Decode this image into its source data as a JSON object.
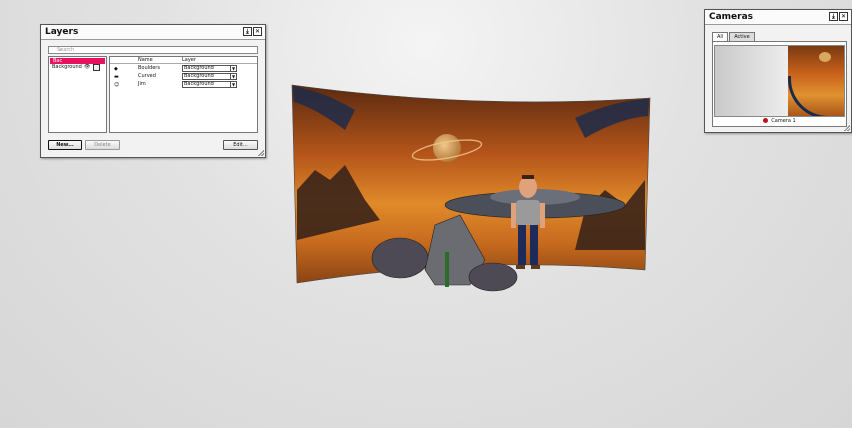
{
  "layers_panel": {
    "title": "Layers",
    "search_placeholder": "Search",
    "layers": [
      "Bac",
      "Background"
    ],
    "columns": {
      "name": "Name",
      "layer": "Layer"
    },
    "objects": [
      {
        "name": "Boulders",
        "layer": "Background",
        "icon": "boulder-icon"
      },
      {
        "name": "Curved",
        "layer": "Background",
        "icon": "curved-backdrop-icon"
      },
      {
        "name": "Jim",
        "layer": "Background",
        "icon": "character-icon"
      }
    ],
    "buttons": {
      "new": "New...",
      "delete": "Delete",
      "edit": "Edit..."
    },
    "selected_color": "#e8125e"
  },
  "cameras_panel": {
    "title": "Cameras",
    "tabs": [
      "All",
      "Active"
    ],
    "camera_name": "Camera 1",
    "indicator_color": "#c0101a"
  },
  "window_buttons": {
    "dock": "⤓",
    "close": "✕"
  }
}
